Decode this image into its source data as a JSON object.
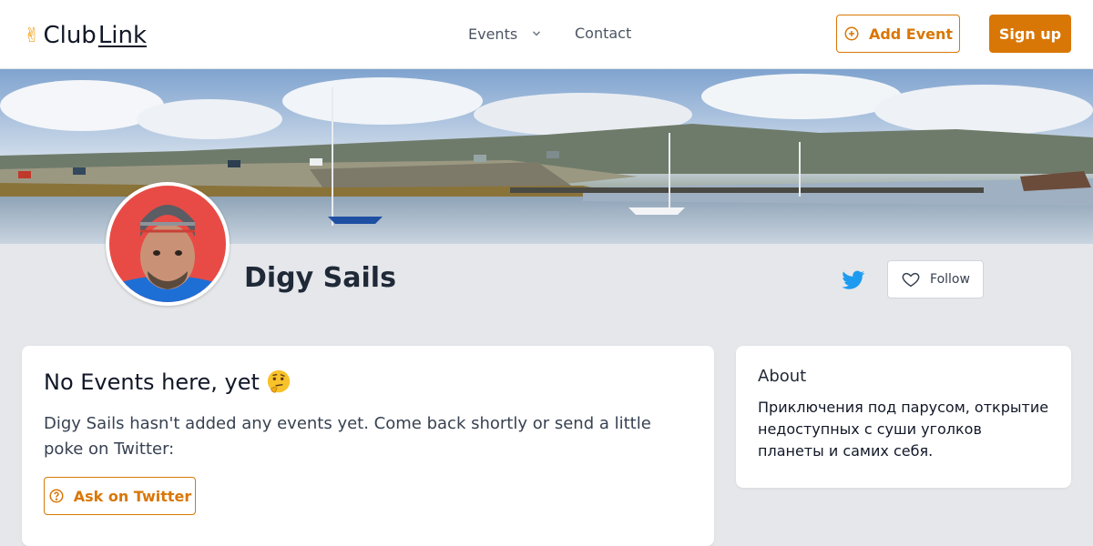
{
  "header": {
    "logo_text_left": "Club",
    "logo_text_right": "Link",
    "nav_events_label": "Events",
    "nav_contact_label": "Contact",
    "add_event_label": "Add Event",
    "signup_label": "Sign up"
  },
  "profile": {
    "name": "Digy Sails",
    "follow_label": "Follow"
  },
  "events_card": {
    "title": "No Events here, yet",
    "message": "Digy Sails hasn't added any events yet. Come back shortly or send a little poke on Twitter:",
    "ask_label": "Ask on Twitter"
  },
  "about_card": {
    "title": "About",
    "text": "Приключения под парусом, открытие недоступных с суши уголков планеты и самих себя."
  },
  "colors": {
    "accent": "#d97706",
    "twitter": "#1d9bf0",
    "background": "#e5e7eb"
  },
  "icons": [
    "victory-hand-icon",
    "chevron-down-icon",
    "plus-circle-icon",
    "twitter-icon",
    "heart-icon",
    "thinking-face-icon",
    "question-circle-icon"
  ]
}
